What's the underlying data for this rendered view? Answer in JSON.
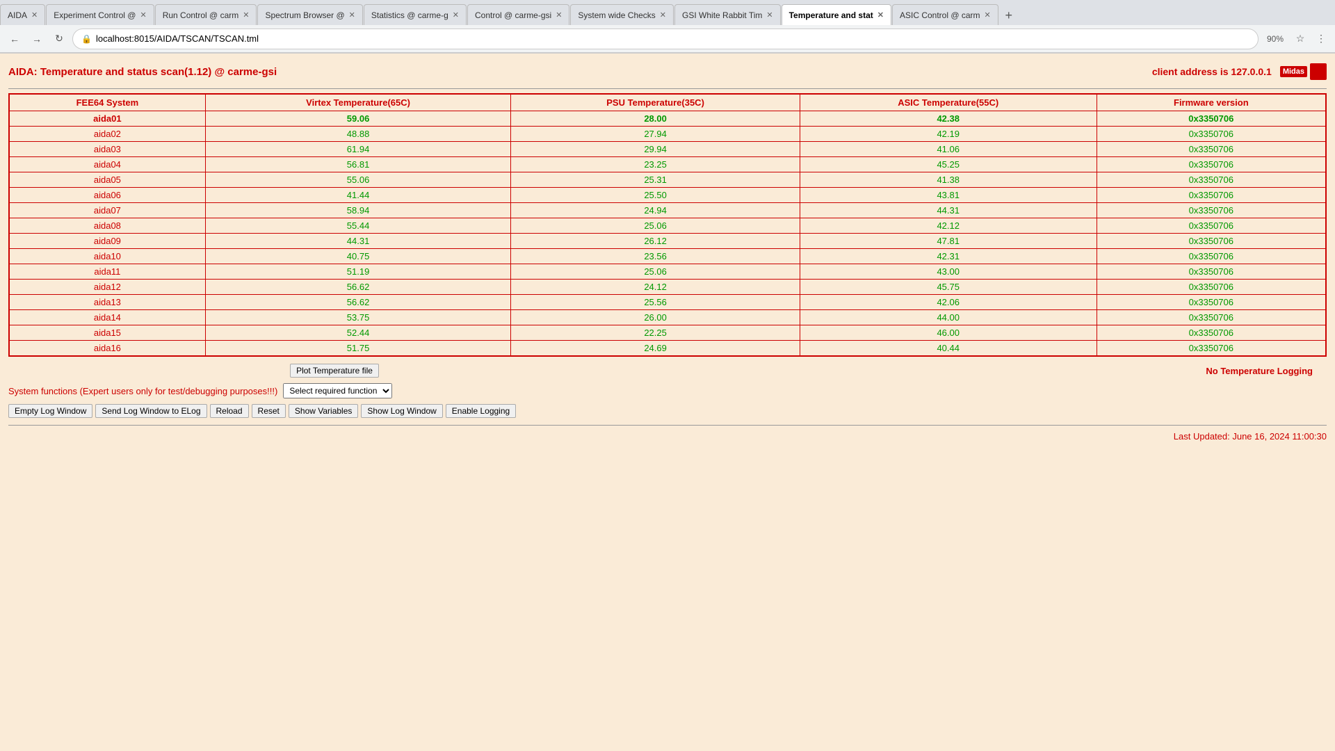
{
  "browser": {
    "tabs": [
      {
        "label": "AIDA",
        "active": false,
        "closable": true
      },
      {
        "label": "Experiment Control @",
        "active": false,
        "closable": true
      },
      {
        "label": "Run Control @ carm",
        "active": false,
        "closable": true
      },
      {
        "label": "Spectrum Browser @",
        "active": false,
        "closable": true
      },
      {
        "label": "Statistics @ carme-g",
        "active": false,
        "closable": true
      },
      {
        "label": "Control @ carme-gsi",
        "active": false,
        "closable": true
      },
      {
        "label": "System wide Checks",
        "active": false,
        "closable": true
      },
      {
        "label": "GSI White Rabbit Tim",
        "active": false,
        "closable": true
      },
      {
        "label": "Temperature and stat",
        "active": true,
        "closable": true
      },
      {
        "label": "ASIC Control @ carm",
        "active": false,
        "closable": true
      }
    ],
    "url": "localhost:8015/AIDA/TSCAN/TSCAN.tml",
    "zoom": "90%"
  },
  "page": {
    "title": "AIDA: Temperature and status scan(1.12) @ carme-gsi",
    "client_address": "client address is 127.0.0.1",
    "table": {
      "headers": [
        "FEE64 System",
        "Virtex Temperature(65C)",
        "PSU Temperature(35C)",
        "ASIC Temperature(55C)",
        "Firmware version"
      ],
      "rows": [
        [
          "aida01",
          "59.06",
          "28.00",
          "42.38",
          "0x3350706"
        ],
        [
          "aida02",
          "48.88",
          "27.94",
          "42.19",
          "0x3350706"
        ],
        [
          "aida03",
          "61.94",
          "29.94",
          "41.06",
          "0x3350706"
        ],
        [
          "aida04",
          "56.81",
          "23.25",
          "45.25",
          "0x3350706"
        ],
        [
          "aida05",
          "55.06",
          "25.31",
          "41.38",
          "0x3350706"
        ],
        [
          "aida06",
          "41.44",
          "25.50",
          "43.81",
          "0x3350706"
        ],
        [
          "aida07",
          "58.94",
          "24.94",
          "44.31",
          "0x3350706"
        ],
        [
          "aida08",
          "55.44",
          "25.06",
          "42.12",
          "0x3350706"
        ],
        [
          "aida09",
          "44.31",
          "26.12",
          "47.81",
          "0x3350706"
        ],
        [
          "aida10",
          "40.75",
          "23.56",
          "42.31",
          "0x3350706"
        ],
        [
          "aida11",
          "51.19",
          "25.06",
          "43.00",
          "0x3350706"
        ],
        [
          "aida12",
          "56.62",
          "24.12",
          "45.75",
          "0x3350706"
        ],
        [
          "aida13",
          "56.62",
          "25.56",
          "42.06",
          "0x3350706"
        ],
        [
          "aida14",
          "53.75",
          "26.00",
          "44.00",
          "0x3350706"
        ],
        [
          "aida15",
          "52.44",
          "22.25",
          "46.00",
          "0x3350706"
        ],
        [
          "aida16",
          "51.75",
          "24.69",
          "40.44",
          "0x3350706"
        ]
      ]
    },
    "plot_btn_label": "Plot Temperature file",
    "no_logging": "No Temperature Logging",
    "system_functions_label": "System functions (Expert users only for test/debugging purposes!!!)",
    "select_placeholder": "Select required function",
    "buttons": [
      "Empty Log Window",
      "Send Log Window to ELog",
      "Reload",
      "Reset",
      "Show Variables",
      "Show Log Window",
      "Enable Logging"
    ],
    "last_updated": "Last Updated: June 16, 2024 11:00:30"
  }
}
